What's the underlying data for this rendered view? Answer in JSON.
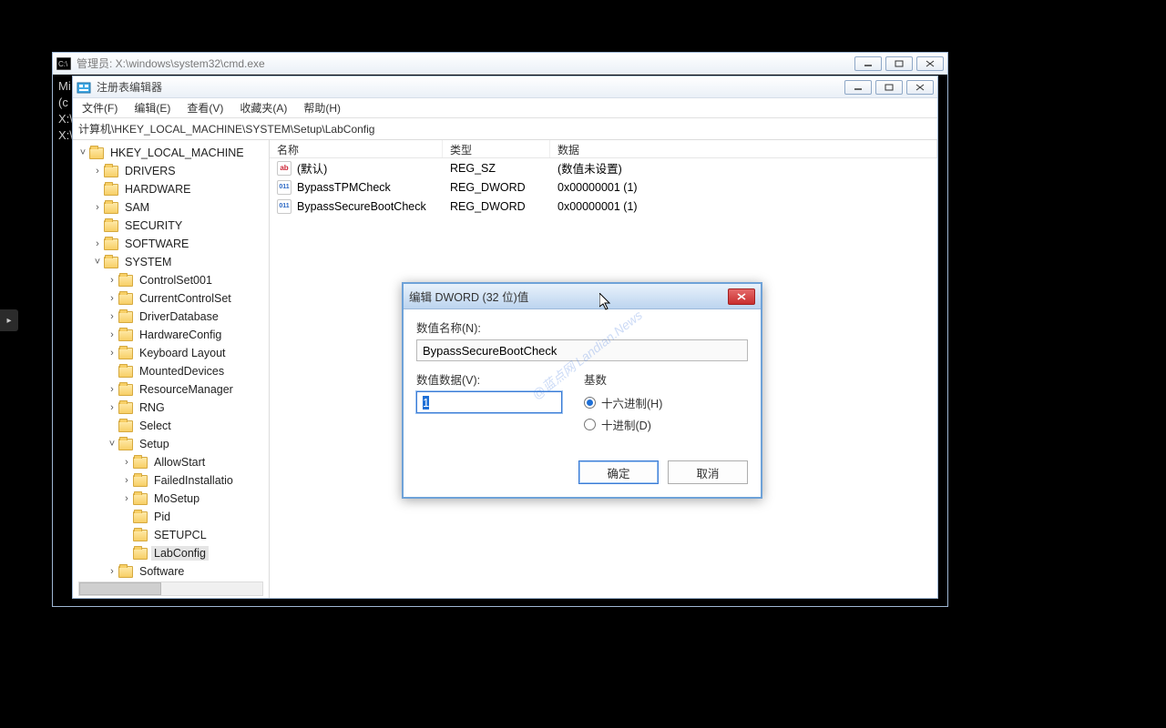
{
  "cmd": {
    "title": "管理员: X:\\windows\\system32\\cmd.exe",
    "lines": [
      "Mi",
      "(c",
      "",
      "X:\\",
      "",
      "X:\\"
    ]
  },
  "regedit": {
    "title": "注册表编辑器",
    "menu": {
      "file": "文件(F)",
      "edit": "编辑(E)",
      "view": "查看(V)",
      "fav": "收藏夹(A)",
      "help": "帮助(H)"
    },
    "address": "计算机\\HKEY_LOCAL_MACHINE\\SYSTEM\\Setup\\LabConfig",
    "tree": {
      "root": "HKEY_LOCAL_MACHINE",
      "nodes": [
        {
          "label": "DRIVERS",
          "indent": 1,
          "expander": ">"
        },
        {
          "label": "HARDWARE",
          "indent": 1,
          "expander": ""
        },
        {
          "label": "SAM",
          "indent": 1,
          "expander": ">"
        },
        {
          "label": "SECURITY",
          "indent": 1,
          "expander": ""
        },
        {
          "label": "SOFTWARE",
          "indent": 1,
          "expander": ">"
        },
        {
          "label": "SYSTEM",
          "indent": 1,
          "expander": "v"
        },
        {
          "label": "ControlSet001",
          "indent": 2,
          "expander": ">"
        },
        {
          "label": "CurrentControlSet",
          "indent": 2,
          "expander": ">"
        },
        {
          "label": "DriverDatabase",
          "indent": 2,
          "expander": ">"
        },
        {
          "label": "HardwareConfig",
          "indent": 2,
          "expander": ">"
        },
        {
          "label": "Keyboard Layout",
          "indent": 2,
          "expander": ">"
        },
        {
          "label": "MountedDevices",
          "indent": 2,
          "expander": ""
        },
        {
          "label": "ResourceManager",
          "indent": 2,
          "expander": ">"
        },
        {
          "label": "RNG",
          "indent": 2,
          "expander": ">"
        },
        {
          "label": "Select",
          "indent": 2,
          "expander": ""
        },
        {
          "label": "Setup",
          "indent": 2,
          "expander": "v"
        },
        {
          "label": "AllowStart",
          "indent": 3,
          "expander": ">"
        },
        {
          "label": "FailedInstallatio",
          "indent": 3,
          "expander": ">"
        },
        {
          "label": "MoSetup",
          "indent": 3,
          "expander": ">"
        },
        {
          "label": "Pid",
          "indent": 3,
          "expander": ""
        },
        {
          "label": "SETUPCL",
          "indent": 3,
          "expander": ""
        },
        {
          "label": "LabConfig",
          "indent": 3,
          "expander": "",
          "selected": true
        },
        {
          "label": "Software",
          "indent": 2,
          "expander": ">"
        }
      ]
    },
    "columns": {
      "name": "名称",
      "type": "类型",
      "data": "数据"
    },
    "values": [
      {
        "icon": "ab",
        "name": "(默认)",
        "type": "REG_SZ",
        "data": "(数值未设置)"
      },
      {
        "icon": "bin",
        "name": "BypassTPMCheck",
        "type": "REG_DWORD",
        "data": "0x00000001 (1)"
      },
      {
        "icon": "bin",
        "name": "BypassSecureBootCheck",
        "type": "REG_DWORD",
        "data": "0x00000001 (1)"
      }
    ]
  },
  "dialog": {
    "title": "编辑 DWORD (32 位)值",
    "name_label": "数值名称(N):",
    "name_value": "BypassSecureBootCheck",
    "data_label": "数值数据(V):",
    "data_value": "1",
    "base_label": "基数",
    "hex_label": "十六进制(H)",
    "dec_label": "十进制(D)",
    "ok": "确定",
    "cancel": "取消"
  },
  "watermark": "@蓝点网 Landian.News"
}
